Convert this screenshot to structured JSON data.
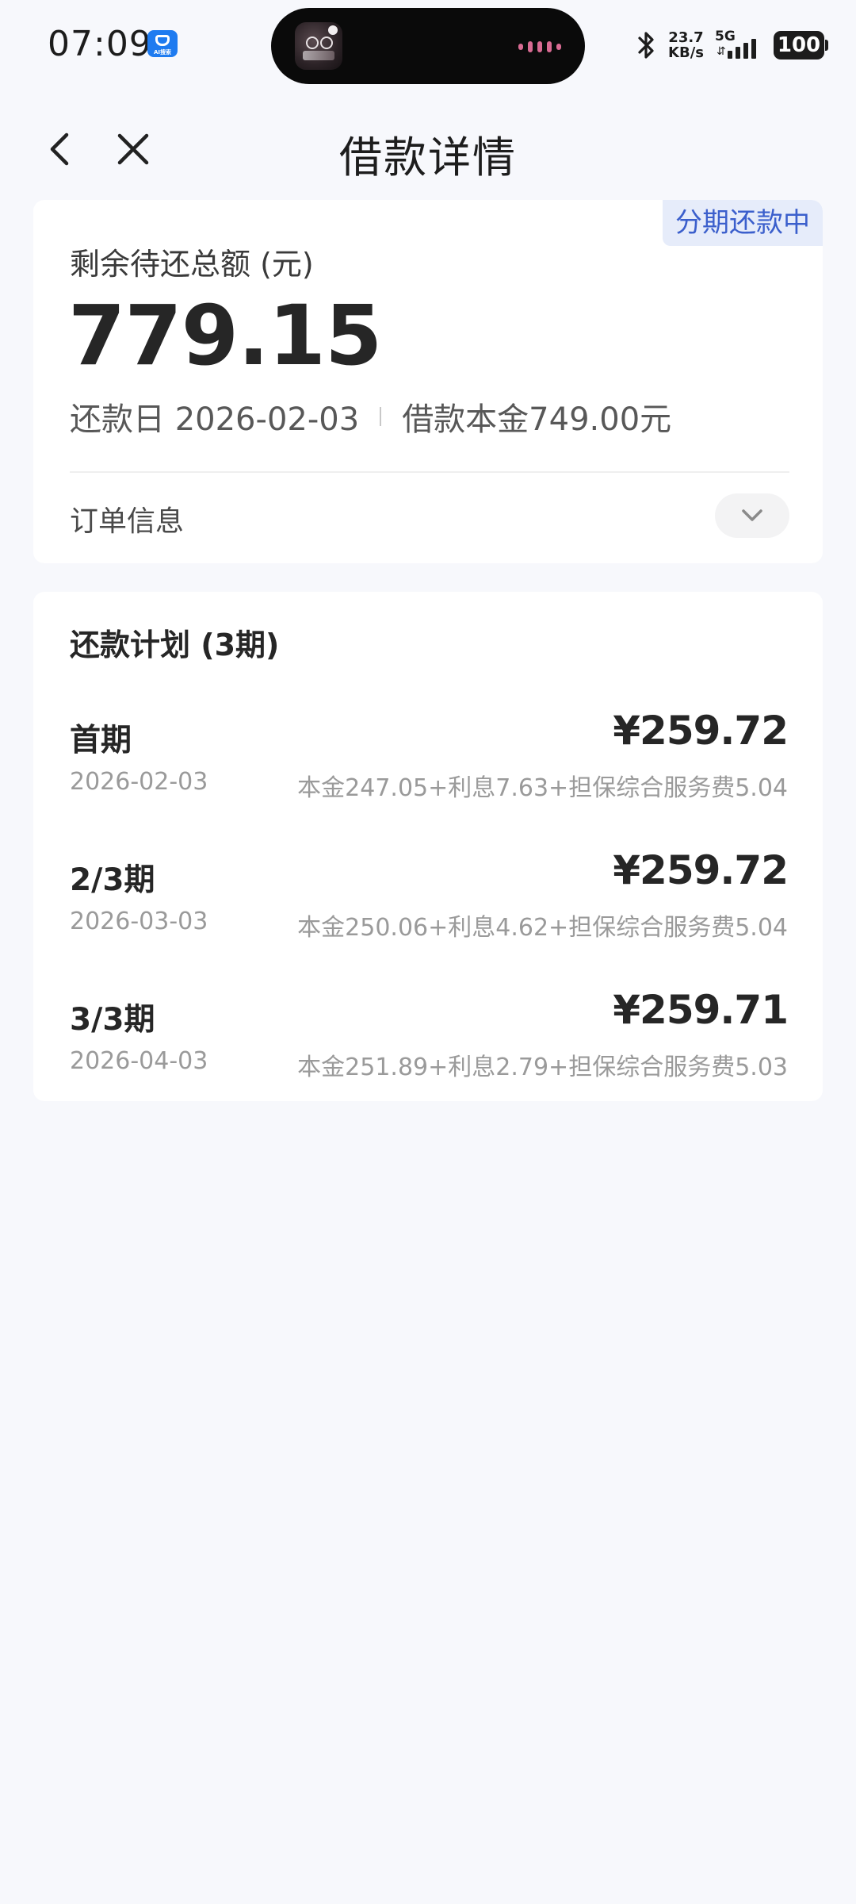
{
  "status_bar": {
    "time": "07:09",
    "app_badge": "AI搜索",
    "net_speed_value": "23.7",
    "net_speed_unit": "KB/s",
    "network_type": "5G",
    "battery": "100"
  },
  "header": {
    "title": "借款详情"
  },
  "summary": {
    "status_tag": "分期还款中",
    "label": "剩余待还总额 (元)",
    "amount": "779.15",
    "due_date_text": "还款日 2026-02-03",
    "principal_text": "借款本金749.00元",
    "order_info_label": "订单信息"
  },
  "plan": {
    "title": "还款计划 (3期)",
    "items": [
      {
        "period": "首期",
        "amount": "¥259.72",
        "date": "2026-02-03",
        "breakdown": "本金247.05+利息7.63+担保综合服务费5.04"
      },
      {
        "period": "2/3期",
        "amount": "¥259.72",
        "date": "2026-03-03",
        "breakdown": "本金250.06+利息4.62+担保综合服务费5.04"
      },
      {
        "period": "3/3期",
        "amount": "¥259.71",
        "date": "2026-04-03",
        "breakdown": "本金251.89+利息2.79+担保综合服务费5.03"
      }
    ]
  },
  "colors": {
    "page_background": "#f7f8fc",
    "card_background": "#ffffff",
    "status_tag_background": "#e6ecfa",
    "status_tag_text": "#3b5fcc",
    "primary_text": "#262626",
    "secondary_text": "#9a9a9a"
  },
  "icons": {
    "back": "chevron-left-icon",
    "close": "close-icon",
    "expand": "chevron-down-icon",
    "bluetooth": "bluetooth-icon",
    "signal": "signal-icon",
    "battery": "battery-icon",
    "app": "app-icon"
  }
}
